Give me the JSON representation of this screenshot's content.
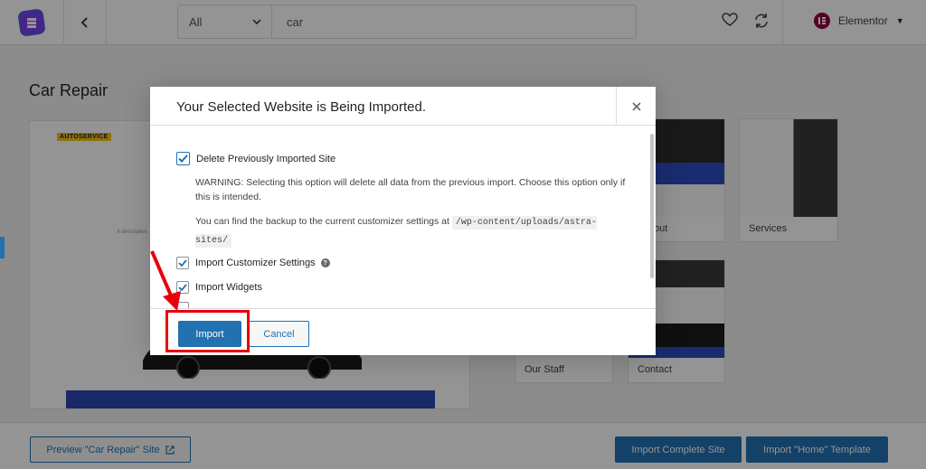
{
  "header": {
    "search_filter": "All",
    "search_value": "car",
    "builder": "Elementor"
  },
  "page": {
    "title": "Car Repair",
    "preview_brand": "AUTOSERVICE",
    "preview_subtext": "A descriptive"
  },
  "thumbnails": [
    {
      "label": "out"
    },
    {
      "label": "Services"
    },
    {
      "label": "Our Staff"
    },
    {
      "label": "Contact"
    }
  ],
  "footer": {
    "preview_label": "Preview \"Car Repair\" Site",
    "import_complete_label": "Import Complete Site",
    "import_template_label": "Import \"Home\" Template"
  },
  "modal": {
    "title": "Your Selected Website is Being Imported.",
    "options": {
      "delete_previous": "Delete Previously Imported Site",
      "customizer": "Import Customizer Settings",
      "widgets": "Import Widgets"
    },
    "warning": "WARNING: Selecting this option will delete all data from the previous import. Choose this option only if this is intended.",
    "backup_text": "You can find the backup to the current customizer settings at",
    "backup_path": "/wp-content/uploads/astra-sites/",
    "import_label": "Import",
    "cancel_label": "Cancel"
  },
  "colors": {
    "accent": "#2271b1",
    "highlight": "#e8000d",
    "elementor": "#92003b"
  }
}
